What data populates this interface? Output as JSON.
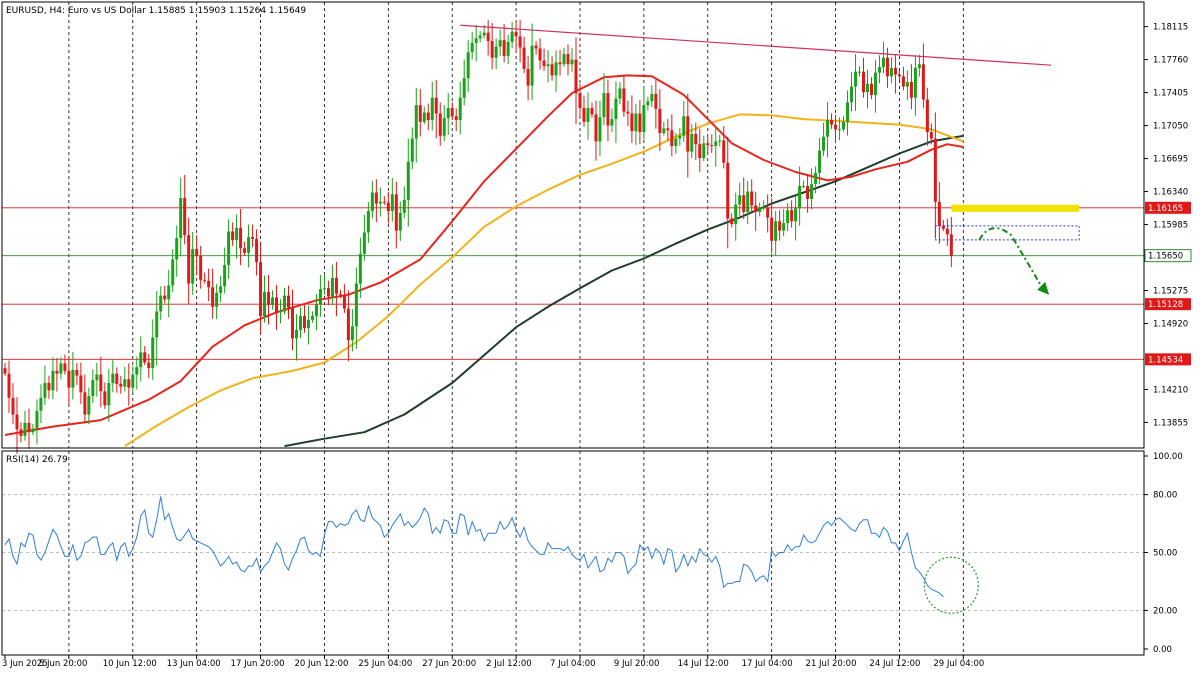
{
  "header": {
    "symbol_line": "EURUSD, H4:  Euro vs US Dollar  1.15885 1.15903 1.15264 1.15649"
  },
  "rsi_panel": {
    "label": "RSI(14) 26.79"
  },
  "colors": {
    "bull": "#19a319",
    "bear": "#e01818",
    "ma_red": "#e8251c",
    "ma_orange": "#f2b31a",
    "ma_dark": "#1f3d2c",
    "rsi_line": "#2e7fd6",
    "resistance_line": "#d0305a",
    "highlight_yellow": "#f2e200",
    "arrow_green": "#138a13"
  },
  "chart_data": [
    {
      "type": "candlestick",
      "title": "EURUSD, H4: Euro vs US Dollar",
      "ylim": [
        1.1358,
        1.1838
      ],
      "y_ticks": [
        "1.18115",
        "1.17760",
        "1.17405",
        "1.17050",
        "1.16695",
        "1.16340",
        "1.15985",
        "1.15275",
        "1.14920",
        "1.14210",
        "1.13855"
      ],
      "y_tick_values": [
        1.18115,
        1.1776,
        1.17405,
        1.1705,
        1.16695,
        1.1634,
        1.15985,
        1.15275,
        1.1492,
        1.1421,
        1.13855
      ],
      "x_labels": [
        "3 Jun 2025",
        "5 Jun 20:00",
        "10 Jun 12:00",
        "13 Jun 04:00",
        "17 Jun 20:00",
        "20 Jun 12:00",
        "25 Jun 04:00",
        "27 Jun 20:00",
        "2 Jul 12:00",
        "7 Jul 04:00",
        "9 Jul 20:00",
        "14 Jul 12:00",
        "17 Jul 04:00",
        "21 Jul 20:00",
        "24 Jul 12:00",
        "29 Jul 04:00"
      ],
      "x_label_index": [
        0,
        16,
        32,
        48,
        64,
        80,
        96,
        112,
        128,
        144,
        160,
        176,
        192,
        208,
        224,
        240
      ],
      "horizontal_levels": [
        {
          "label": "1.16165",
          "value": 1.16165,
          "color": "#e01818"
        },
        {
          "label": "1.15650",
          "value": 1.1565,
          "color": "#2e8b2e"
        },
        {
          "label": "1.15128",
          "value": 1.15128,
          "color": "#e01818"
        },
        {
          "label": "1.14534",
          "value": 1.14534,
          "color": "#e01818"
        }
      ],
      "resistance_trendline": {
        "from": [
          114,
          1.1813
        ],
        "to": [
          262,
          1.177
        ]
      },
      "yellow_zone": {
        "x0": 237,
        "x1": 269,
        "value": 1.1616
      },
      "blue_box": {
        "x0": 233,
        "x1": 269,
        "y0": 1.1582,
        "y1": 1.1597
      },
      "arrow_path": [
        [
          244,
          1.1582
        ],
        [
          247,
          1.1596
        ],
        [
          252,
          1.1587
        ],
        [
          256,
          1.1558
        ],
        [
          261,
          1.1526
        ]
      ],
      "close_series": [
        1.1438,
        1.1412,
        1.1394,
        1.1378,
        1.1371,
        1.1385,
        1.1375,
        1.1379,
        1.1398,
        1.1412,
        1.1428,
        1.142,
        1.1441,
        1.1438,
        1.1449,
        1.1441,
        1.1423,
        1.1442,
        1.1436,
        1.1418,
        1.1394,
        1.1414,
        1.1431,
        1.1437,
        1.1419,
        1.1404,
        1.1428,
        1.1438,
        1.1427,
        1.1424,
        1.1432,
        1.1423,
        1.1437,
        1.1445,
        1.1461,
        1.145,
        1.1444,
        1.1477,
        1.1505,
        1.1522,
        1.1518,
        1.1533,
        1.1561,
        1.1584,
        1.1627,
        1.1587,
        1.1535,
        1.1572,
        1.1565,
        1.1539,
        1.1538,
        1.1531,
        1.151,
        1.1525,
        1.1532,
        1.1555,
        1.1591,
        1.1582,
        1.1595,
        1.1573,
        1.1568,
        1.1585,
        1.1583,
        1.1558,
        1.15,
        1.1526,
        1.1512,
        1.152,
        1.1504,
        1.1505,
        1.1522,
        1.1509,
        1.1476,
        1.1485,
        1.15,
        1.1487,
        1.1496,
        1.15,
        1.1513,
        1.1529,
        1.153,
        1.1521,
        1.1541,
        1.1524,
        1.1523,
        1.1508,
        1.1474,
        1.1489,
        1.1535,
        1.1567,
        1.159,
        1.1613,
        1.1633,
        1.1621,
        1.1623,
        1.1622,
        1.1613,
        1.1631,
        1.1592,
        1.1611,
        1.1625,
        1.1666,
        1.1691,
        1.1727,
        1.1709,
        1.1719,
        1.1711,
        1.1735,
        1.1718,
        1.1694,
        1.1713,
        1.1724,
        1.1715,
        1.1711,
        1.1735,
        1.1756,
        1.1784,
        1.1794,
        1.1799,
        1.1802,
        1.1805,
        1.1796,
        1.1778,
        1.179,
        1.1797,
        1.178,
        1.1795,
        1.1806,
        1.1801,
        1.1789,
        1.1766,
        1.1748,
        1.1791,
        1.1788,
        1.1775,
        1.1769,
        1.1771,
        1.1759,
        1.1773,
        1.1771,
        1.1782,
        1.1771,
        1.1776,
        1.174,
        1.1724,
        1.1709,
        1.1724,
        1.1717,
        1.1688,
        1.1714,
        1.174,
        1.1705,
        1.1712,
        1.1734,
        1.1745,
        1.172,
        1.1718,
        1.1699,
        1.1718,
        1.1698,
        1.1727,
        1.1731,
        1.1739,
        1.1723,
        1.1697,
        1.1702,
        1.17,
        1.1683,
        1.1691,
        1.1694,
        1.1715,
        1.1677,
        1.1696,
        1.1685,
        1.167,
        1.1686,
        1.1684,
        1.1683,
        1.1688,
        1.1689,
        1.1665,
        1.1605,
        1.1599,
        1.162,
        1.163,
        1.1612,
        1.1634,
        1.1619,
        1.1612,
        1.1617,
        1.1617,
        1.1606,
        1.1581,
        1.1602,
        1.1592,
        1.16,
        1.1614,
        1.1602,
        1.1616,
        1.164,
        1.164,
        1.1626,
        1.1642,
        1.1654,
        1.1678,
        1.1693,
        1.1711,
        1.1706,
        1.1701,
        1.1701,
        1.1709,
        1.173,
        1.1747,
        1.1763,
        1.1763,
        1.1741,
        1.175,
        1.1738,
        1.1762,
        1.1768,
        1.1778,
        1.1758,
        1.1767,
        1.176,
        1.1758,
        1.1747,
        1.1752,
        1.1735,
        1.1767,
        1.1771,
        1.1733,
        1.1698,
        1.1691,
        1.1623,
        1.1597,
        1.1594,
        1.1588,
        1.1565
      ],
      "ma_red_series": [
        [
          0,
          1.1372
        ],
        [
          12,
          1.1381
        ],
        [
          24,
          1.1388
        ],
        [
          36,
          1.141
        ],
        [
          44,
          1.143
        ],
        [
          52,
          1.1467
        ],
        [
          60,
          1.149
        ],
        [
          68,
          1.1504
        ],
        [
          78,
          1.1517
        ],
        [
          86,
          1.1523
        ],
        [
          94,
          1.1536
        ],
        [
          104,
          1.1561
        ],
        [
          112,
          1.1602
        ],
        [
          120,
          1.1645
        ],
        [
          128,
          1.168
        ],
        [
          136,
          1.1715
        ],
        [
          142,
          1.174
        ],
        [
          150,
          1.1757
        ],
        [
          156,
          1.1759
        ],
        [
          162,
          1.1758
        ],
        [
          170,
          1.1738
        ],
        [
          176,
          1.1712
        ],
        [
          182,
          1.1686
        ],
        [
          190,
          1.1668
        ],
        [
          198,
          1.1655
        ],
        [
          206,
          1.1646
        ],
        [
          212,
          1.165
        ],
        [
          218,
          1.1658
        ],
        [
          226,
          1.1666
        ],
        [
          232,
          1.1679
        ],
        [
          236,
          1.1685
        ],
        [
          240,
          1.1682
        ]
      ],
      "ma_orange_series": [
        [
          30,
          1.136
        ],
        [
          38,
          1.1382
        ],
        [
          46,
          1.1402
        ],
        [
          54,
          1.142
        ],
        [
          62,
          1.1433
        ],
        [
          72,
          1.1441
        ],
        [
          80,
          1.145
        ],
        [
          88,
          1.1472
        ],
        [
          96,
          1.15
        ],
        [
          104,
          1.1534
        ],
        [
          112,
          1.1563
        ],
        [
          120,
          1.1596
        ],
        [
          128,
          1.1618
        ],
        [
          136,
          1.1636
        ],
        [
          144,
          1.1652
        ],
        [
          152,
          1.1664
        ],
        [
          160,
          1.1677
        ],
        [
          168,
          1.1693
        ],
        [
          176,
          1.1707
        ],
        [
          184,
          1.1717
        ],
        [
          192,
          1.1716
        ],
        [
          200,
          1.1712
        ],
        [
          208,
          1.171
        ],
        [
          216,
          1.1708
        ],
        [
          224,
          1.1706
        ],
        [
          232,
          1.1701
        ],
        [
          240,
          1.1688
        ]
      ],
      "ma_dark_series": [
        [
          70,
          1.136
        ],
        [
          80,
          1.1368
        ],
        [
          90,
          1.1375
        ],
        [
          100,
          1.1394
        ],
        [
          112,
          1.1428
        ],
        [
          120,
          1.1458
        ],
        [
          128,
          1.1488
        ],
        [
          136,
          1.151
        ],
        [
          144,
          1.153
        ],
        [
          152,
          1.1549
        ],
        [
          160,
          1.1562
        ],
        [
          168,
          1.1578
        ],
        [
          176,
          1.1593
        ],
        [
          184,
          1.1606
        ],
        [
          192,
          1.1621
        ],
        [
          200,
          1.1633
        ],
        [
          208,
          1.1645
        ],
        [
          216,
          1.166
        ],
        [
          224,
          1.1675
        ],
        [
          232,
          1.1688
        ],
        [
          240,
          1.1694
        ]
      ]
    },
    {
      "type": "line",
      "title": "RSI(14) 26.79",
      "ylim": [
        0,
        100
      ],
      "y_ticks": [
        "100.00",
        "80.00",
        "50.00",
        "20.00",
        "0.00"
      ],
      "y_tick_values": [
        100,
        80,
        50,
        20,
        0
      ],
      "level_lines": [
        80,
        50,
        20
      ],
      "circle_annotation": {
        "x": 237,
        "y": 33
      },
      "values": [
        54,
        57,
        48,
        44,
        55,
        53,
        60,
        59,
        49,
        46,
        50,
        56,
        62,
        59,
        53,
        48,
        48,
        54,
        46,
        48,
        55,
        56,
        58,
        58,
        49,
        49,
        53,
        55,
        46,
        53,
        55,
        48,
        52,
        58,
        69,
        72,
        60,
        58,
        67,
        79,
        67,
        70,
        63,
        57,
        56,
        59,
        62,
        57,
        56,
        55,
        54,
        53,
        51,
        47,
        43,
        45,
        48,
        44,
        45,
        41,
        40,
        43,
        43,
        47,
        40,
        43,
        45,
        50,
        55,
        52,
        44,
        41,
        47,
        51,
        57,
        58,
        51,
        49,
        50,
        48,
        59,
        66,
        66,
        63,
        65,
        64,
        65,
        70,
        72,
        67,
        66,
        74,
        68,
        66,
        64,
        58,
        60,
        64,
        67,
        70,
        64,
        66,
        63,
        65,
        68,
        73,
        70,
        60,
        63,
        60,
        67,
        66,
        60,
        60,
        70,
        69,
        59,
        66,
        61,
        62,
        56,
        60,
        60,
        60,
        66,
        62,
        64,
        68,
        62,
        58,
        63,
        56,
        53,
        51,
        49,
        49,
        55,
        52,
        52,
        52,
        51,
        53,
        49,
        47,
        46,
        49,
        42,
        45,
        48,
        40,
        41,
        47,
        45,
        50,
        50,
        48,
        39,
        42,
        44,
        54,
        51,
        53,
        47,
        52,
        50,
        44,
        52,
        51,
        40,
        43,
        49,
        43,
        48,
        45,
        52,
        49,
        48,
        45,
        48,
        43,
        32,
        34,
        34,
        35,
        35,
        44,
        43,
        40,
        35,
        37,
        38,
        35,
        51,
        48,
        50,
        50,
        54,
        51,
        53,
        53,
        59,
        56,
        55,
        56,
        60,
        64,
        66,
        64,
        67,
        68,
        66,
        64,
        62,
        61,
        65,
        67,
        67,
        60,
        60,
        58,
        63,
        61,
        55,
        55,
        51,
        56,
        60,
        50,
        42,
        40,
        37,
        33,
        31,
        30,
        29,
        27
      ]
    }
  ]
}
